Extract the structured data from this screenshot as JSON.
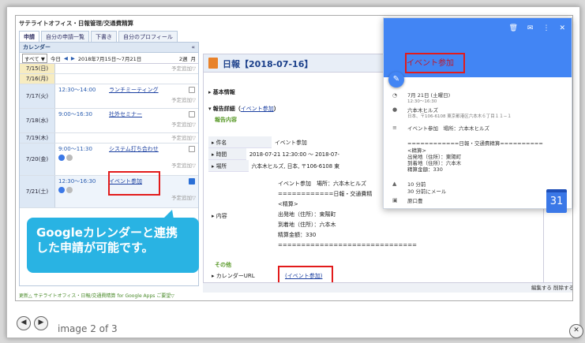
{
  "viewer": {
    "caption": "image 2 of 3",
    "prev_icon": "◀",
    "next_icon": "▶",
    "close_icon": "✕"
  },
  "app": {
    "title": "サテライトオフィス・日報管理/交通費精算",
    "tabs": [
      "申請",
      "自分の申請一覧",
      "下書き",
      "自分のプロフィール"
    ]
  },
  "calendar": {
    "header": "カレンダー",
    "collapse": "«",
    "view_select": "すべて ▼",
    "today": "今日",
    "prev": "◀",
    "next": "▶",
    "range": "2018年7月15日〜7月21日",
    "view_week2": "2週",
    "view_month": "月",
    "add_label": "予定追加▽",
    "days": [
      {
        "date": "7/15(日)",
        "events": []
      },
      {
        "date": "7/16(月)",
        "events": []
      },
      {
        "date": "7/17(火)",
        "events": [
          {
            "time": "12:30〜14:00",
            "name": "ランチミーティング"
          }
        ]
      },
      {
        "date": "7/18(水)",
        "events": [
          {
            "time": "9:00〜16:30",
            "name": "社外セミナー"
          }
        ]
      },
      {
        "date": "7/19(木)",
        "events": []
      },
      {
        "date": "7/20(金)",
        "events": [
          {
            "time": "9:00〜11:30",
            "name": "システム打ち合わせ"
          }
        ]
      },
      {
        "date": "7/21(土)",
        "events": [
          {
            "time": "12:30〜16:30",
            "name": "イベント参加"
          }
        ]
      }
    ],
    "footer": "更新△ サテライトオフィス・日報/交通費精算 for Google Apps ご要望▽"
  },
  "report": {
    "title": "日報【2018-07-16】",
    "basic_info": "基本情報",
    "detail_prefix": "報告詳細（",
    "detail_link": "イベント参加",
    "detail_suffix": "）",
    "content_heading": "報告内容",
    "rows": [
      {
        "k": "件名",
        "v": "イベント参加"
      },
      {
        "k": "時間",
        "v": "2018-07-21 12:30:00 〜 2018-07-"
      },
      {
        "k": "場所",
        "v": "六本木ヒルズ, 日本, 〒106-6108 東"
      }
    ],
    "content_label": "内容",
    "content_lines": [
      "イベント参加　場所：六本木ヒルズ",
      "",
      "============日報・交通費精",
      "<精算>",
      "出発地（住所）：東陽町",
      "到着地（住所）：六本木",
      "精算金額：330",
      "=============================="
    ],
    "other": "その他",
    "calendar_url_label": "カレンダーURL",
    "calendar_url_link": "(イベント参加)",
    "bottom_actions": "編集する 削除する"
  },
  "popup": {
    "title": "イベント参加",
    "icons": [
      "🗑",
      "✉",
      "⋮",
      "✕"
    ],
    "edit_icon": "✎",
    "date": "7月 21日 (土曜日)",
    "time": "12:30〜16:30",
    "place": "六本木ヒルズ",
    "address": "日本、〒106-6108 東京都港区六本木６丁目１１−１",
    "desc": "イベント参加　場所：六本木ヒルズ",
    "desc2": "============日報・交通費精算==========",
    "desc3": "<精算>",
    "desc4": "出発地（住所）：東陽町",
    "desc5": "到着地（住所）：六本木",
    "desc6": "精算金額：330",
    "reminder1": "10 分前",
    "reminder2": "30 分前にメール",
    "owner": "原口豊",
    "cal_icon": "31"
  },
  "callout": {
    "line1": "Googleカレンダーと連携",
    "line2": "した申請が可能です。"
  }
}
